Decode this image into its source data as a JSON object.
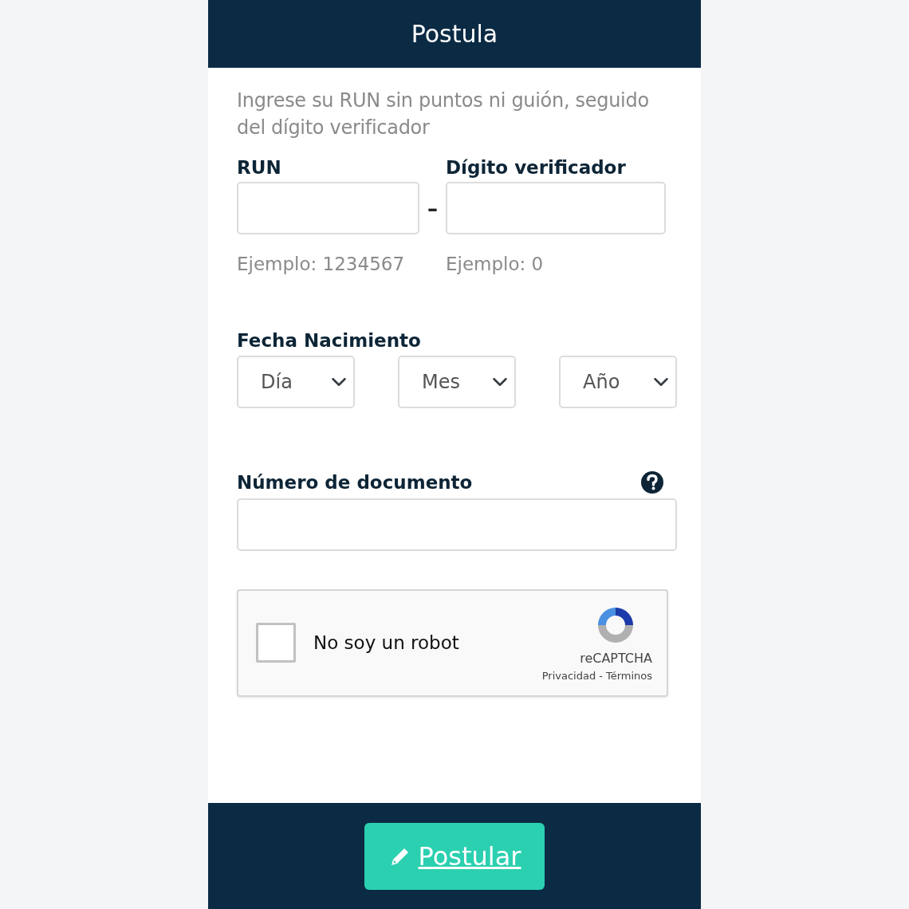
{
  "header": {
    "title": "Postula"
  },
  "instructions": "Ingrese su RUN sin puntos ni guión, seguido del dígito verificador",
  "run_fields": [
    {
      "label": "RUN",
      "hint": "Ejemplo: 1234567"
    },
    {
      "label": "Dígito verificador",
      "hint": "Ejemplo: 0"
    }
  ],
  "run_separator": "–",
  "birth_date": {
    "label": "Fecha Nacimiento",
    "selects": [
      "Día",
      "Mes",
      "Año"
    ]
  },
  "document": {
    "label": "Número de documento"
  },
  "recaptcha": {
    "label": "No soy un robot",
    "checked": false,
    "brand": "reCAPTCHA",
    "links": [
      "Privacidad",
      "Términos"
    ],
    "separator": "-"
  },
  "submit": {
    "label": "Postular"
  }
}
